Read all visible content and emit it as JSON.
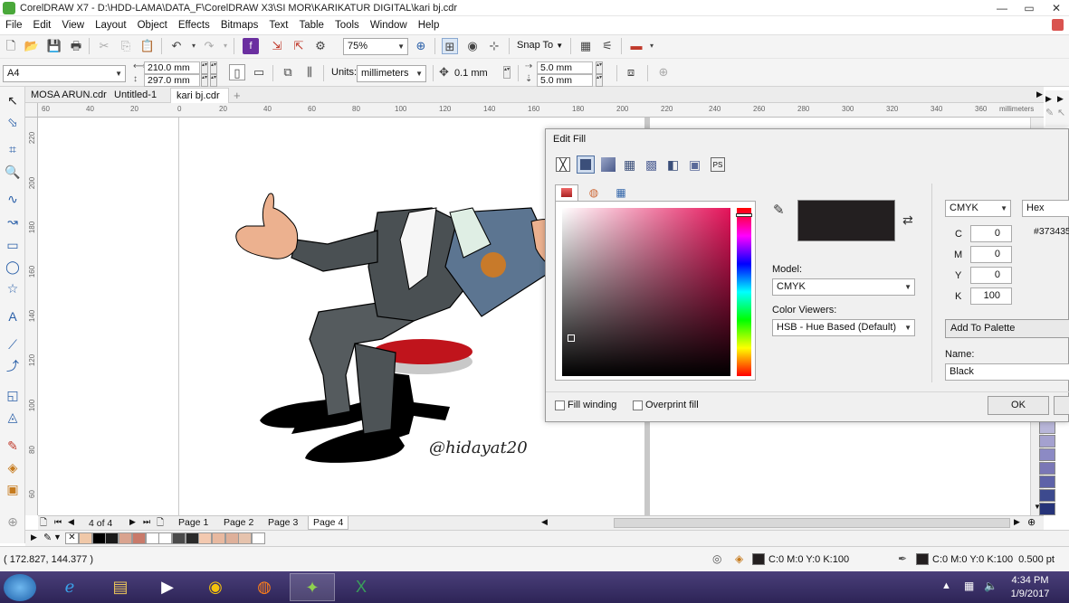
{
  "window": {
    "title": "CorelDRAW X7 - D:\\HDD-LAMA\\DATA_F\\CorelDRAW X3\\SI MOR\\KARIKATUR DIGITAL\\kari bj.cdr",
    "minimize": "—",
    "restore": "▭",
    "close": "✕"
  },
  "menu": [
    "File",
    "Edit",
    "View",
    "Layout",
    "Object",
    "Effects",
    "Bitmaps",
    "Text",
    "Table",
    "Tools",
    "Window",
    "Help"
  ],
  "toolbar": {
    "zoom": "75%",
    "snap_to": "Snap To"
  },
  "propbar": {
    "page_size": "A4",
    "width": "210.0 mm",
    "height": "297.0 mm",
    "units_label": "Units:",
    "units": "millimeters",
    "nudge": "0.1 mm",
    "dup_x": "5.0 mm",
    "dup_y": "5.0 mm"
  },
  "doc_tabs": [
    "MOSA ARUN.cdr",
    "Untitled-1",
    "kari bj.cdr"
  ],
  "ruler": {
    "h_ticks": [
      "60",
      "40",
      "20",
      "0",
      "20",
      "40",
      "60",
      "80",
      "100",
      "120",
      "140",
      "160",
      "180",
      "200",
      "220",
      "240",
      "260",
      "280",
      "300",
      "320",
      "340",
      "360"
    ],
    "h_unit": "millimeters",
    "v_ticks": [
      "220",
      "200",
      "180",
      "160",
      "140",
      "120",
      "100",
      "80",
      "60"
    ],
    "v_unit": "millimeters"
  },
  "canvas": {
    "watermark": "@hidayat20"
  },
  "pages": {
    "counter": "4 of 4",
    "tabs": [
      "Page 1",
      "Page 2",
      "Page 3",
      "Page 4"
    ]
  },
  "palette": [
    "#f0c8a8",
    "#000000",
    "#1a1a1a",
    "#d9a38f",
    "#c97a6a",
    "#ffffff",
    "#ffffff",
    "#4a4a4a",
    "#2a2a2a",
    "#f3c9b0",
    "#e8b9a0",
    "#deb09a",
    "#e6c3ad",
    "#ffffff"
  ],
  "status": {
    "coords": "( 172.827, 144.377 )",
    "fill": "C:0 M:0 Y:0 K:100",
    "outline": "C:0 M:0 Y:0 K:100  0.500 pt"
  },
  "taskbar": {
    "time": "4:34 PM",
    "date": "1/9/2017"
  },
  "dialog": {
    "title": "Edit Fill",
    "model_label": "Model:",
    "model": "CMYK",
    "viewers_label": "Color Viewers:",
    "viewer": "HSB - Hue Based (Default)",
    "colorspace": "CMYK",
    "hex_label": "Hex",
    "hex_value": "#373435",
    "c_label": "C",
    "c": "0",
    "m_label": "M",
    "m": "0",
    "y_label": "Y",
    "y": "0",
    "k_label": "K",
    "k": "100",
    "add_palette": "Add To Palette",
    "name_label": "Name:",
    "name": "Black",
    "fill_winding": "Fill winding",
    "overprint": "Overprint fill",
    "ok": "OK",
    "swatch_color": "#231f20"
  }
}
